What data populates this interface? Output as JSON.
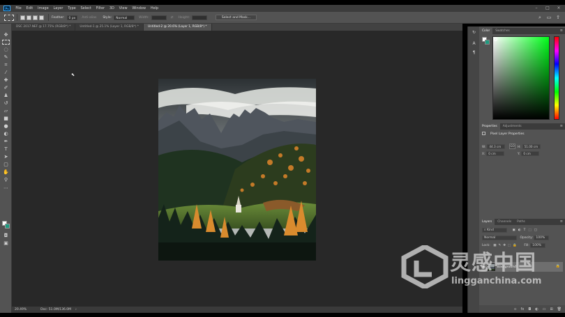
{
  "app": {
    "logo_text": "Ps"
  },
  "menu": [
    "File",
    "Edit",
    "Image",
    "Layer",
    "Type",
    "Select",
    "Filter",
    "3D",
    "View",
    "Window",
    "Help"
  ],
  "options_bar": {
    "feather_label": "Feather:",
    "feather_value": "0 px",
    "antialias_label": "Anti-alias",
    "style_label": "Style:",
    "style_value": "Normal",
    "width_label": "Width:",
    "height_label": "Height:",
    "select_mask_button": "Select and Mask..."
  },
  "tabs": [
    {
      "label": "DSC 2017.NEF @ 17.75% (RGB/8*) *",
      "active": false
    },
    {
      "label": "Untitled-1 @ 25.1% (Layer 1, RGB/8*) *",
      "active": false
    },
    {
      "label": "Untitled-2 @ 20.6% (Layer 1, RGB/8*) *",
      "active": true
    }
  ],
  "status_bar": {
    "zoom": "20.49%",
    "doc": "Doc: 51.0M/136.0M"
  },
  "panels": {
    "color_tabs": [
      "Color",
      "Swatches"
    ],
    "properties_tabs": [
      "Properties",
      "Adjustments"
    ],
    "properties": {
      "title": "Pixel Layer Properties",
      "w_label": "W:",
      "w_value": "44.3 cm",
      "h_label": "H:",
      "h_value": "51.00 cm",
      "x_label": "X:",
      "x_value": "0 cm",
      "y_label": "Y:",
      "y_value": "0 cm",
      "link_label": "GO"
    },
    "layers_tabs": [
      "Layers",
      "Channels",
      "Paths"
    ],
    "layers": {
      "kind_label": "Kind",
      "blend_mode": "Normal",
      "opacity_label": "Opacity:",
      "opacity_value": "100%",
      "lock_label": "Lock:",
      "fill_label": "Fill:",
      "fill_value": "100%",
      "background_layer": "Background"
    }
  },
  "watermark": {
    "chinese": "灵感中国",
    "latin": "lingganchina.com"
  },
  "colors": {
    "foreground": "#ffffff",
    "background": "#1e9b80",
    "canvas_bg": "#282828",
    "panel_bg": "#535353"
  }
}
